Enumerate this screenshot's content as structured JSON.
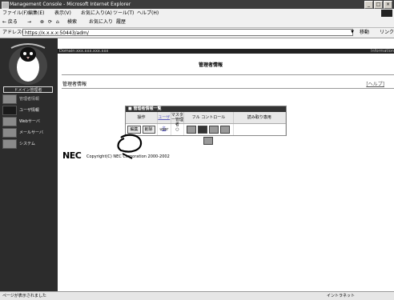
{
  "window": {
    "title": "Management Console - Microsoft Internet Explorer",
    "min": "_",
    "max": "□",
    "close": "×"
  },
  "menubar": {
    "items": [
      "ファイル(F)",
      "編集(E)",
      "表示(V)",
      "お気に入り(A)",
      "ツール(T)",
      "ヘルプ(H)"
    ]
  },
  "toolbar": {
    "back": "← 戻る",
    "forward": "→",
    "stop": "⊗",
    "refresh": "⟳",
    "home": "⌂",
    "search": "検索",
    "favorites": "お気に入り",
    "history": "履歴"
  },
  "addressbar": {
    "label": "アドレス(D)",
    "url": "https://x.x.x.x:50443/adm/",
    "go": "移動",
    "links": "リンク"
  },
  "sidebar": {
    "menu_head": "ドメイン管理者",
    "items": [
      {
        "label": "管理者情報",
        "icon": "admin-info-icon"
      },
      {
        "label": "ユーザ情報",
        "icon": "user-info-icon"
      },
      {
        "label": "Webサーバ",
        "icon": "web-server-icon"
      },
      {
        "label": "メールサーバ",
        "icon": "mail-server-icon"
      },
      {
        "label": "システム",
        "icon": "system-icon"
      }
    ]
  },
  "content": {
    "domain_label": "Domain:xxx.xxx.xxx.xxx",
    "info_tag": "Information",
    "page_title": "管理者情報",
    "subtitle": "管理者情報",
    "help": "[ヘルプ]"
  },
  "table": {
    "caption": "■ 管理者情報一覧",
    "headers": [
      "操作",
      "ユーザ名",
      "マスター管理者",
      "フル コントロール",
      "読み取り専用"
    ],
    "row": {
      "edit": "編集",
      "delete": "削除",
      "username": "user",
      "master": "○"
    }
  },
  "footer": {
    "brand": "NEC",
    "copyright": "Copyright(C) NEC Corporation 2000-2002"
  },
  "statusbar": {
    "status": "ページが表示されました",
    "zone": "イントラネット"
  }
}
